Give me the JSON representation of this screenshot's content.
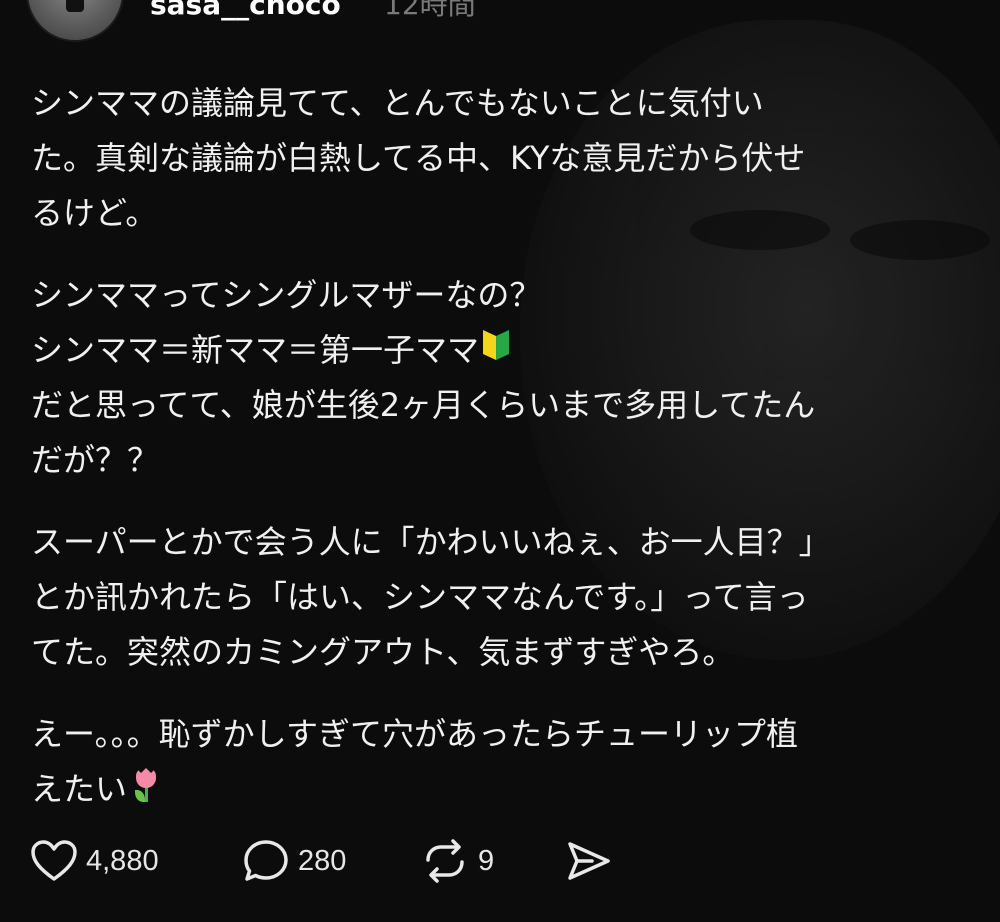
{
  "header": {
    "username": "sasa__choco",
    "time": "12時間",
    "more_icon": "more-icon"
  },
  "post": {
    "paragraphs": [
      "シンママの議論見てて、とんでもないことに気付い\nた。真剣な議論が白熱してる中、KYな意見だから伏せ\nるけど。",
      "シンママってシングルマザーなの？\nシンママ＝新ママ＝第一子ママ",
      "だと思ってて、娘が生後2ヶ月くらいまで多用してたん\nだが？？",
      "スーパーとかで会う人に「かわいいねぇ、お一人目？」\nとか訊かれたら「はい、シンママなんです。」って言っ\nてた。突然のカミングアウト、気まずすぎやろ。",
      "えー。。。恥ずかしすぎて穴があったらチューリップ植\nえたい"
    ],
    "emoji": {
      "beginner": "beginner-mark-icon",
      "tulip": "tulip-icon"
    }
  },
  "actions": {
    "like_count": "4,880",
    "reply_count": "280",
    "repost_count": "9",
    "icons": [
      "heart-icon",
      "comment-icon",
      "repost-icon",
      "share-icon"
    ]
  },
  "colors": {
    "background": "#0c0c0c",
    "text": "#f0f0f0",
    "muted": "#7a7a7a"
  }
}
